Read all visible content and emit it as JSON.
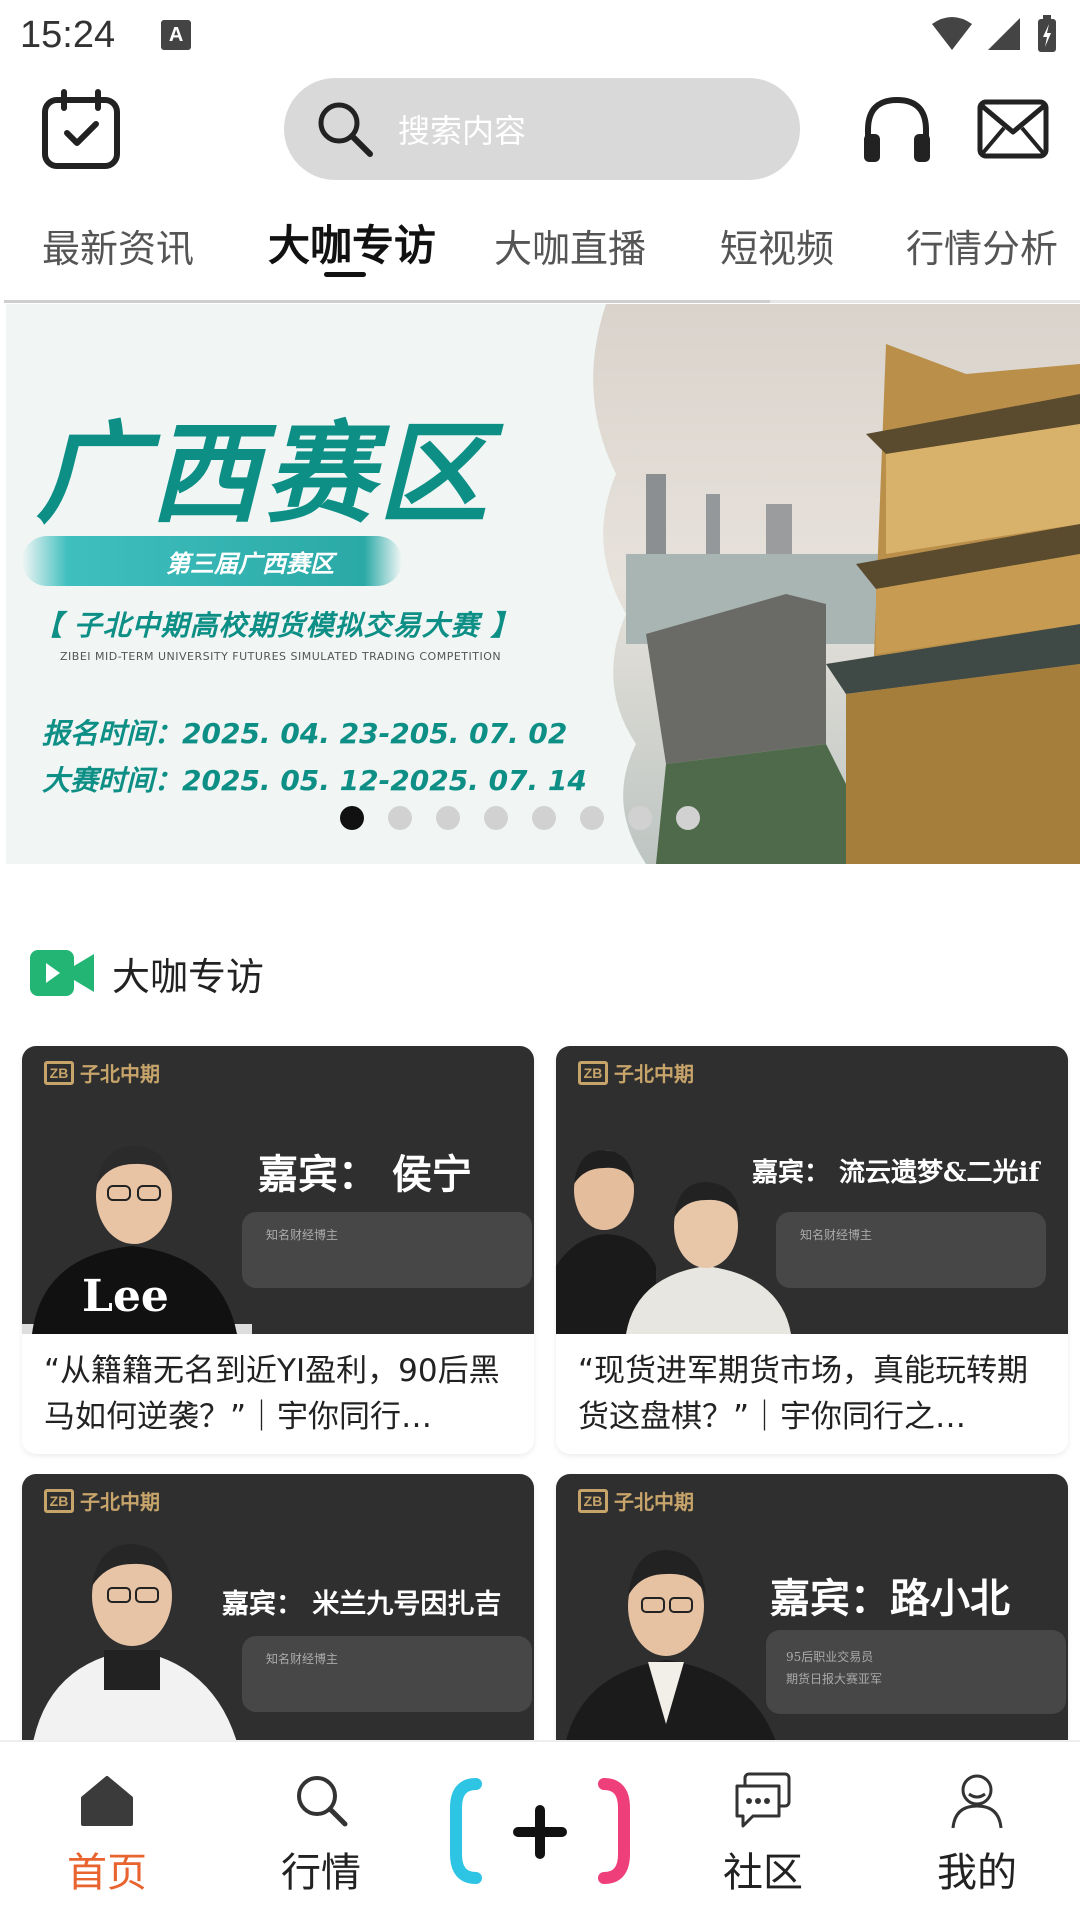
{
  "status_bar": {
    "time": "15:24",
    "input_indicator": "A"
  },
  "search": {
    "placeholder": "搜索内容"
  },
  "tabs": [
    {
      "label": "最新资讯",
      "active": false
    },
    {
      "label": "大咖专访",
      "active": true
    },
    {
      "label": "大咖直播",
      "active": false
    },
    {
      "label": "短视频",
      "active": false
    },
    {
      "label": "行情分析",
      "active": false
    }
  ],
  "banner": {
    "title": "广西赛区",
    "ribbon": "第三届广西赛区",
    "subtitle": "【 子北中期高校期货模拟交易大赛 】",
    "subtitle_en": "ZIBEI MID-TERM UNIVERSITY FUTURES SIMULATED TRADING COMPETITION",
    "date_line_1": "报名时间：2025. 04. 23-205. 07. 02",
    "date_line_2": "大赛时间：2025. 05. 12-2025. 07. 14",
    "slide_count": 8,
    "active_slide": 1
  },
  "section": {
    "title": "大咖专访"
  },
  "cards": [
    {
      "logo": "子北中期",
      "guest": "嘉宾：  侯宁",
      "plate": "知名财经博主",
      "title": "“从籍籍无名到近YI盈利，90后黑马如何逆袭？”｜宇你同行…"
    },
    {
      "logo": "子北中期",
      "guest": "嘉宾：  流云遗梦&二光if",
      "plate": "知名财经博主",
      "title": "“现货进军期货市场，真能玩转期货这盘棋？”｜宇你同行之…"
    },
    {
      "logo": "子北中期",
      "guest": "嘉宾：  米兰九号因扎吉",
      "plate": "知名财经博主",
      "title": ""
    },
    {
      "logo": "子北中期",
      "guest": "嘉宾：路小北",
      "plate": "95后职业交易员\n期货日报大赛亚军",
      "title": ""
    }
  ],
  "bottom_nav": [
    {
      "label": "首页",
      "icon": "home-icon",
      "active": true
    },
    {
      "label": "行情",
      "icon": "search-icon",
      "active": false
    },
    {
      "label": "",
      "icon": "plus-icon",
      "active": false
    },
    {
      "label": "社区",
      "icon": "chat-icon",
      "active": false
    },
    {
      "label": "我的",
      "icon": "person-icon",
      "active": false
    }
  ],
  "colors": {
    "accent": "#e8632e",
    "banner_teal": "#0e8f86",
    "section_icon": "#22b573"
  }
}
